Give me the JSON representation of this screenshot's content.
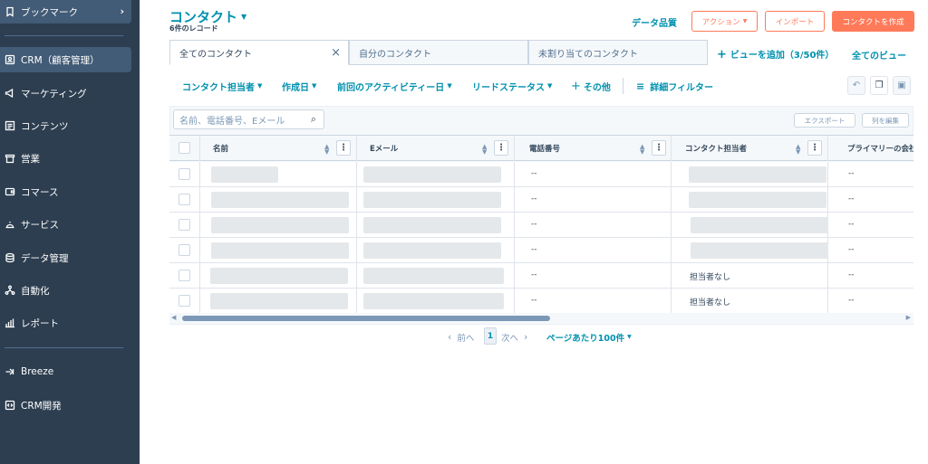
{
  "sidebar": {
    "bookmark": {
      "label": "ブックマーク",
      "icon": "bookmark-icon"
    },
    "items": [
      {
        "label": "CRM（顧客管理）",
        "icon": "contacts-icon",
        "active": true
      },
      {
        "label": "マーケティング",
        "icon": "megaphone-icon"
      },
      {
        "label": "コンテンツ",
        "icon": "content-icon"
      },
      {
        "label": "営業",
        "icon": "sales-icon"
      },
      {
        "label": "コマース",
        "icon": "commerce-icon"
      },
      {
        "label": "サービス",
        "icon": "service-icon"
      },
      {
        "label": "データ管理",
        "icon": "database-icon"
      },
      {
        "label": "自動化",
        "icon": "automation-icon"
      },
      {
        "label": "レポート",
        "icon": "report-icon"
      }
    ],
    "bottom": [
      {
        "label": "Breeze",
        "icon": "breeze-icon"
      },
      {
        "label": "CRM開発",
        "icon": "dev-icon"
      }
    ]
  },
  "header": {
    "title": "コンタクト",
    "record_count": "6件のレコード",
    "data_quality": "データ品質",
    "actions": "アクション",
    "import": "インポート",
    "create": "コンタクトを作成"
  },
  "tabs": [
    {
      "label": "全てのコンタクト",
      "active": true
    },
    {
      "label": "自分のコンタクト"
    },
    {
      "label": "未割り当てのコンタクト"
    }
  ],
  "add_view": "ビューを追加（3/50件）",
  "all_views": "全てのビュー",
  "filters": {
    "owner": "コンタクト担当者",
    "created": "作成日",
    "last_activity": "前回のアクティビティー日",
    "lead_status": "リードステータス",
    "more": "その他",
    "advanced": "詳細フィルター"
  },
  "table": {
    "search_placeholder": "名前、電話番号、Eメール",
    "export": "エクスポート",
    "edit_columns": "列を編集",
    "columns": [
      "名前",
      "Eメール",
      "電話番号",
      "コンタクト担当者",
      "プライマリーの会社"
    ],
    "rows": [
      {
        "phone": "--",
        "owner": "",
        "company": "--"
      },
      {
        "phone": "--",
        "owner": "",
        "company": "--"
      },
      {
        "phone": "--",
        "owner": "",
        "company": "--"
      },
      {
        "phone": "--",
        "owner": "",
        "company": "--"
      },
      {
        "phone": "--",
        "owner": "担当者なし",
        "company": "--"
      },
      {
        "phone": "--",
        "owner": "担当者なし",
        "company": "--"
      }
    ]
  },
  "pagination": {
    "prev": "前へ",
    "page": "1",
    "next": "次へ",
    "per_page": "ページあたり100件"
  }
}
